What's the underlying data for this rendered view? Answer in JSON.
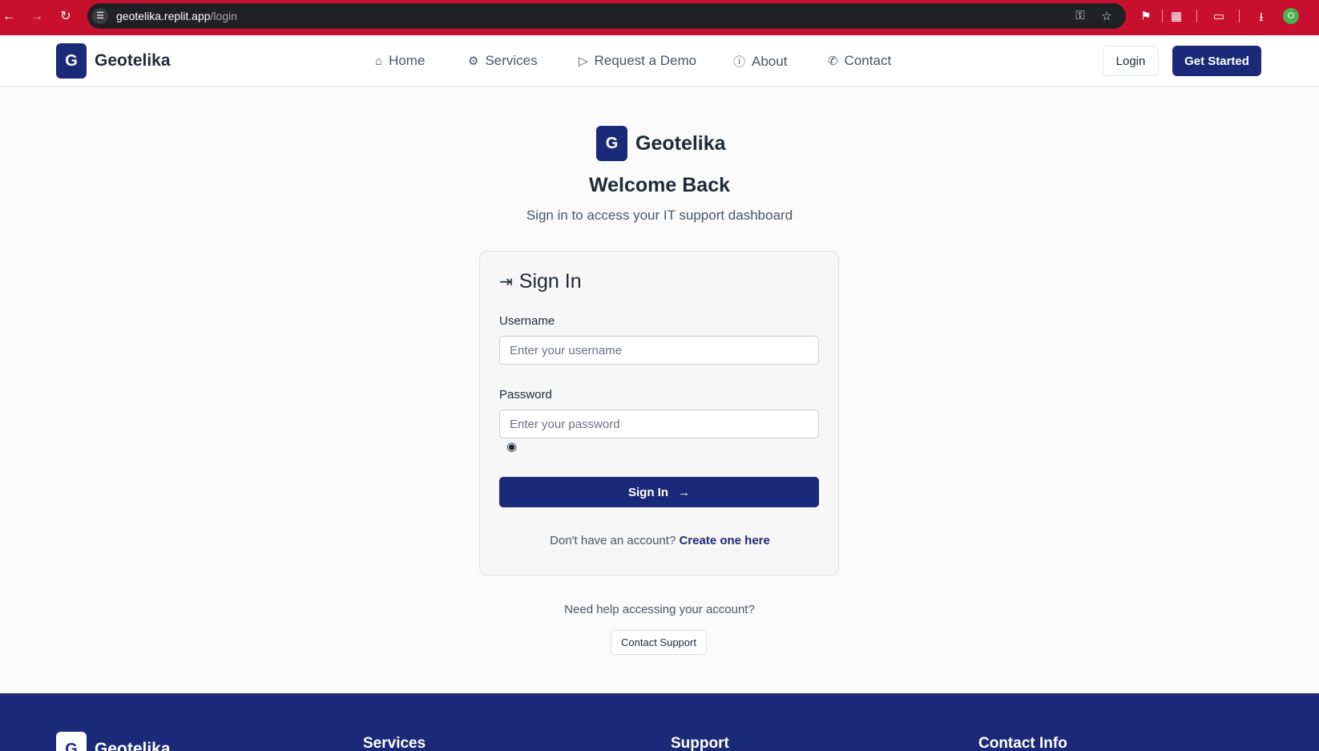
{
  "browser": {
    "url_host": "geotelika.replit.app",
    "url_path": "/login",
    "profile_initial": "O"
  },
  "header": {
    "brand_letter": "G",
    "brand_name": "Geotelika",
    "nav": [
      {
        "label": "Home",
        "icon": "home-icon"
      },
      {
        "label": "Services",
        "icon": "gear-icon"
      },
      {
        "label": "Request a Demo",
        "icon": "play-icon"
      },
      {
        "label": "About",
        "icon": "info-icon"
      },
      {
        "label": "Contact",
        "icon": "phone-icon"
      }
    ],
    "login_label": "Login",
    "get_started_label": "Get Started"
  },
  "hero": {
    "brand_letter": "G",
    "brand_name": "Geotelika",
    "title": "Welcome Back",
    "subtitle": "Sign in to access your IT support dashboard"
  },
  "form": {
    "title": "Sign In",
    "username_label": "Username",
    "username_placeholder": "Enter your username",
    "username_value": "",
    "password_label": "Password",
    "password_placeholder": "Enter your password",
    "password_value": "",
    "submit_label": "Sign In",
    "signup_prompt": "Don't have an account?",
    "signup_link": "Create one here"
  },
  "help": {
    "text": "Need help accessing your account?",
    "button_label": "Contact Support"
  },
  "footer": {
    "brand_letter": "G",
    "brand_name": "Geotelika",
    "columns": [
      "Services",
      "Support",
      "Contact Info"
    ]
  },
  "colors": {
    "brand": "#1b2a78",
    "browser_frame": "#c8102e"
  }
}
